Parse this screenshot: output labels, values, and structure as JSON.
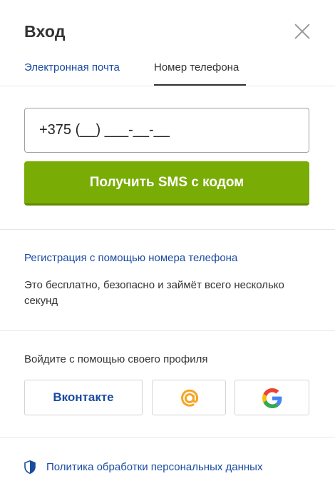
{
  "dialog": {
    "title": "Вход",
    "close_icon": "close-icon"
  },
  "tabs": [
    {
      "label": "Электронная почта",
      "active": false
    },
    {
      "label": "Номер телефона",
      "active": true
    }
  ],
  "phone": {
    "value": "+375 (__) ___-__-__"
  },
  "sms_button": {
    "label": "Получить SMS с кодом",
    "color": "#79ad05"
  },
  "register": {
    "link": "Регистрация с помощью номера телефона",
    "note": "Это бесплатно, безопасно и займёт всего несколько секунд"
  },
  "social": {
    "label": "Войдите с помощью своего профиля",
    "buttons": [
      {
        "label": "Вконтакте",
        "icon": "vk-text"
      },
      {
        "label": "",
        "icon": "mail-at-icon"
      },
      {
        "label": "",
        "icon": "google-icon"
      }
    ]
  },
  "privacy": {
    "label": "Политика обработки персональных данных",
    "icon": "shield-icon"
  },
  "colors": {
    "link": "#1a4ba0",
    "text": "#333333",
    "accent_green": "#79ad05",
    "mail_orange": "#f5a623"
  }
}
